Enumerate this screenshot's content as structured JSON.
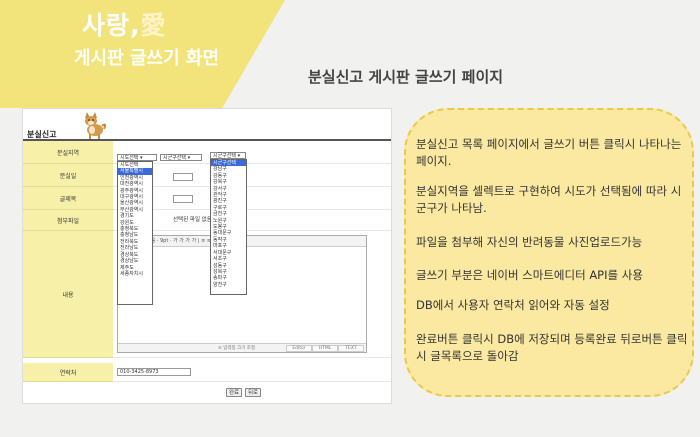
{
  "header": {
    "brand_part1": "사랑,",
    "brand_part2": "愛",
    "subtitle": "게시판 글쓰기 화면",
    "page_title": "분실신고 게시판 글쓰기 페이지"
  },
  "form": {
    "title": "분실신고",
    "labels": {
      "region": "분실지역",
      "date": "분실일",
      "subject": "글제목",
      "attachment": "첨부파일",
      "content": "내용",
      "contact": "연락처"
    },
    "sido_select": "시도선택",
    "sigungu_select": "시군구선택",
    "sigungu_select2": "시군구선택",
    "sido_options": [
      "시도선택",
      "서울특별시",
      "인천광역시",
      "대전광역시",
      "광주광역시",
      "대구광역시",
      "울산광역시",
      "부산광역시",
      "경기도",
      "강원도",
      "충청북도",
      "충청남도",
      "전라북도",
      "전라남도",
      "경상북도",
      "경상남도",
      "제주도",
      "세종자치시"
    ],
    "sido_highlight_index": 1,
    "gu_options": [
      "시군구선택",
      "강남구",
      "강동구",
      "강북구",
      "강서구",
      "관악구",
      "광진구",
      "구로구",
      "금천구",
      "노원구",
      "도봉구",
      "동대문구",
      "동작구",
      "마포구",
      "서대문구",
      "서초구",
      "성동구",
      "성북구",
      "송파구",
      "양천구"
    ],
    "gu_highlight_index": 0,
    "file_text": "선택된 파일 없음",
    "toolbar_text": "돋움 · 9pt · 가 가 가 가 | ≡ ≡ ≡ ≡ · ⊕ Ω",
    "editor_resize": "≡ 입력창 크기 조절",
    "editor_modes": [
      "Editor",
      "HTML",
      "TEXT"
    ],
    "contact_value": "010-3425-8973",
    "buttons": {
      "done": "완료",
      "back": "뒤로"
    }
  },
  "notes": [
    "분실신고 목록 페이지에서 글쓰기 버튼 클릭시 나타나는 페이지.",
    "분실지역을 셀렉트로 구현하여 시도가 선택됨에 따라 시군구가 나타남.",
    "파일을 첨부해 자신의 반려동물 사진업로드가능",
    "글쓰기 부분은 네이버 스마트에디터 API를 사용",
    "DB에서 사용자 연락처 읽어와 자동 설정",
    "완료버튼 클릭시 DB에 저장되며 등록완료 뒤로버튼 클릭시 글목록으로 돌아감"
  ],
  "colors": {
    "banner": "#f2e47a",
    "label_bg": "#f6f0a8",
    "note_bg": "#fbe9a1",
    "note_border": "#e9c94c",
    "highlight": "#3a6ad8"
  }
}
